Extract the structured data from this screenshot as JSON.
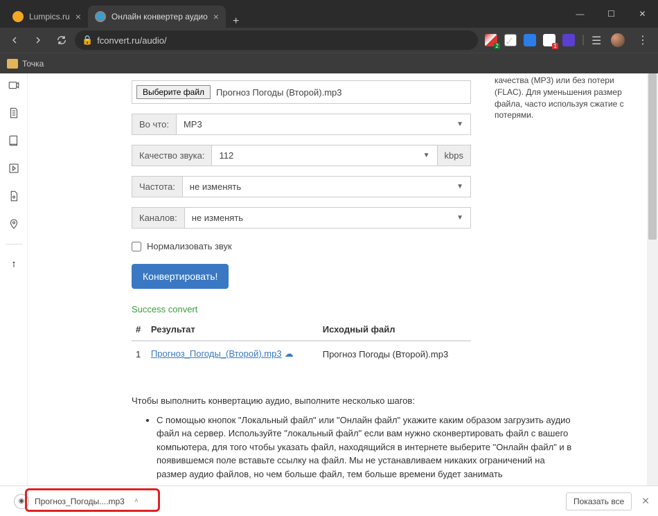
{
  "tabs": {
    "inactive": {
      "title": "Lumpics.ru"
    },
    "active": {
      "title": "Онлайн конвертер аудио"
    }
  },
  "addressbar": {
    "url": "fconvert.ru/audio/"
  },
  "bookmarks": {
    "item1": "Точка"
  },
  "extensions": {
    "badge1": "2",
    "badge2": "1"
  },
  "form": {
    "file_button": "Выберите файл",
    "file_name": "Прогноз Погоды (Второй).mp3",
    "format_label": "Во что:",
    "format_value": "MP3",
    "quality_label": "Качество звука:",
    "quality_value": "112",
    "quality_suffix": "kbps",
    "freq_label": "Частота:",
    "freq_value": "не изменять",
    "channels_label": "Каналов:",
    "channels_value": "не изменять",
    "normalize_label": "Нормализовать звук",
    "convert_button": "Конвертировать!"
  },
  "result": {
    "success": "Success convert",
    "col_num": "#",
    "col_result": "Результат",
    "col_source": "Исходный файл",
    "row_num": "1",
    "row_result": "Прогноз_Погоды_(Второй).mp3",
    "row_source": "Прогноз Погоды (Второй).mp3"
  },
  "instructions": {
    "intro": "Чтобы выполнить конвертацию аудио, выполните несколько шагов:",
    "step1": "С помощью кнопок \"Локальный файл\" или \"Онлайн файл\" укажите каким образом загрузить аудио файл на сервер. Используйте \"локальный файл\" если вам нужно сконвертировать файл с вашего компьютера, для того чтобы указать файл, находящийся в интернете выберите \"Онлайн файл\" и в появившемся поле вставьте ссылку на файл. Мы не устанавливаем никаких ограничений на размер аудио файлов, но чем больше файл, тем больше времени будет занимать"
  },
  "sideinfo": {
    "text": "качества (MP3) или без потери (FLAC). Для уменьшения размер файла, часто используя сжатие с потерями."
  },
  "download": {
    "filename": "Прогноз_Погоды....mp3",
    "show_all": "Показать все"
  }
}
